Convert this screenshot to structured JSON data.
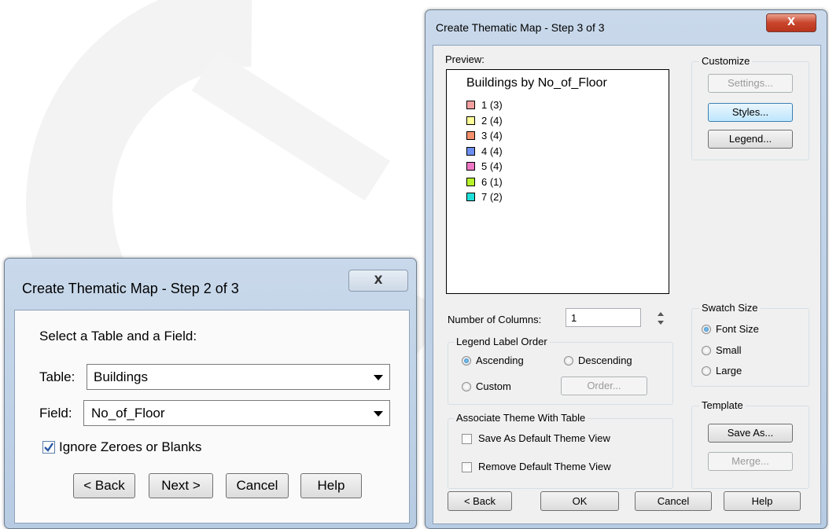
{
  "dialog_step2": {
    "title": "Create Thematic Map - Step 2 of 3",
    "close_glyph": "X",
    "prompt": "Select a Table and a Field:",
    "table_label": "Table:",
    "table_value": "Buildings",
    "field_label": "Field:",
    "field_value": "No_of_Floor",
    "ignore_label": "Ignore Zeroes or Blanks",
    "ignore_checked": true,
    "buttons": {
      "back": "< Back",
      "next": "Next >",
      "cancel": "Cancel",
      "help": "Help"
    }
  },
  "dialog_step3": {
    "title": "Create Thematic Map - Step 3 of 3",
    "close_glyph": "X",
    "preview_label": "Preview:",
    "legend_title": "Buildings by No_of_Floor",
    "legend_items": [
      {
        "label": "1 (3)",
        "color": "#f4a0a0"
      },
      {
        "label": "2 (4)",
        "color": "#ffff99"
      },
      {
        "label": "3 (4)",
        "color": "#f4916c"
      },
      {
        "label": "4 (4)",
        "color": "#6b8ef0"
      },
      {
        "label": "5 (4)",
        "color": "#ef76c5"
      },
      {
        "label": "6 (1)",
        "color": "#b6f22a"
      },
      {
        "label": "7 (2)",
        "color": "#1ee0d9"
      }
    ],
    "customize": {
      "label": "Customize",
      "settings": "Settings...",
      "styles": "Styles...",
      "legend": "Legend..."
    },
    "columns_label": "Number of Columns:",
    "columns_value": "1",
    "order": {
      "label": "Legend Label Order",
      "ascending": "Ascending",
      "descending": "Descending",
      "custom": "Custom",
      "order_button": "Order...",
      "selected": "Ascending"
    },
    "swatch": {
      "label": "Swatch Size",
      "font_size": "Font Size",
      "small": "Small",
      "large": "Large",
      "selected": "Font Size"
    },
    "associate": {
      "label": "Associate Theme With Table",
      "save_default": "Save As Default Theme View",
      "remove_default": "Remove Default Theme View"
    },
    "template": {
      "label": "Template",
      "save_as": "Save As...",
      "merge": "Merge..."
    },
    "buttons": {
      "back": "< Back",
      "ok": "OK",
      "cancel": "Cancel",
      "help": "Help"
    }
  },
  "colors": {
    "accent": "#3c7fb1",
    "title_bar": "#c4d5ea",
    "close_red": "#c9452c"
  }
}
